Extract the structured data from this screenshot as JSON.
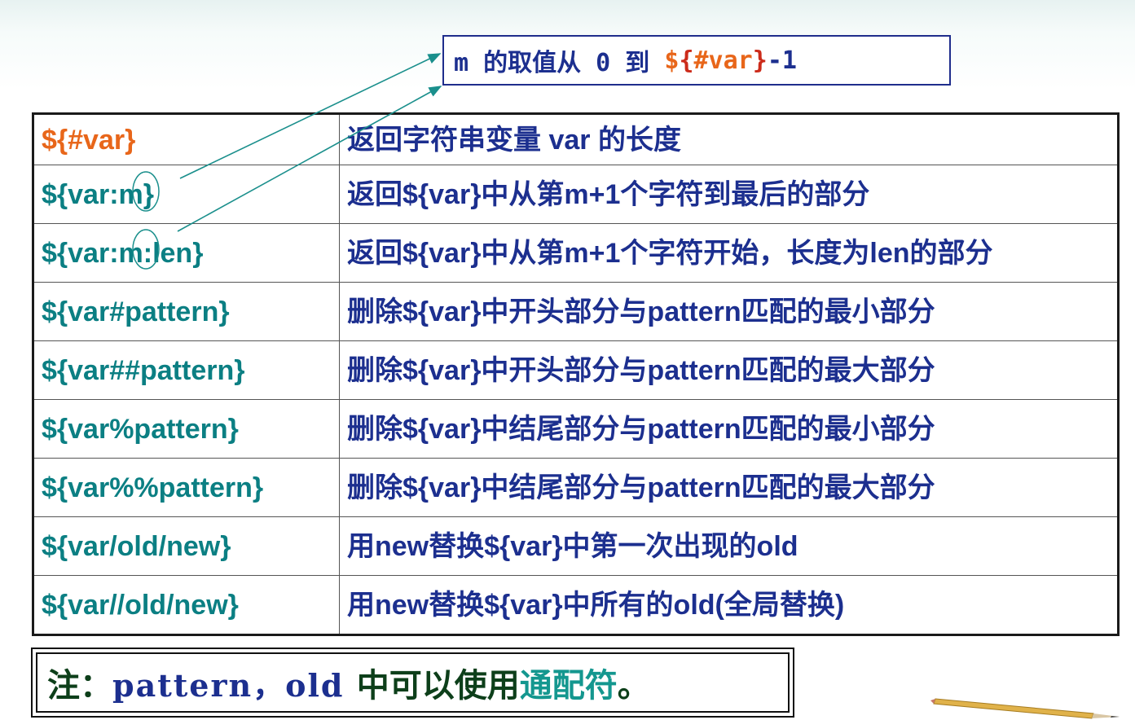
{
  "callout": {
    "prefix": "m 的取值从 0 到 ",
    "dollar": "$",
    "open": "{",
    "var": "#var",
    "close": "}",
    "suffix": "-1"
  },
  "rows": [
    {
      "expr": "${#var}",
      "desc": "返回字符串变量 var 的长度"
    },
    {
      "expr": "${var:m}",
      "desc": "返回${var}中从第m+1个字符到最后的部分"
    },
    {
      "expr": "${var:m:len}",
      "desc": "返回${var}中从第m+1个字符开始，长度为len的部分"
    },
    {
      "expr": "${var#pattern}",
      "desc": "删除${var}中开头部分与pattern匹配的最小部分"
    },
    {
      "expr": "${var##pattern}",
      "desc": "删除${var}中开头部分与pattern匹配的最大部分"
    },
    {
      "expr": "${var%pattern}",
      "desc": "删除${var}中结尾部分与pattern匹配的最小部分"
    },
    {
      "expr": "${var%%pattern}",
      "desc": "删除${var}中结尾部分与pattern匹配的最大部分"
    },
    {
      "expr": "${var/old/new}",
      "desc": "用new替换${var}中第一次出现的old"
    },
    {
      "expr": "${var//old/new}",
      "desc": "用new替换${var}中所有的old(全局替换)"
    }
  ],
  "note": {
    "label": "注：",
    "terms": "pattern，old ",
    "middle": "中可以使用",
    "highlight": "通配符",
    "end": "。"
  },
  "colors": {
    "teal": "#0b7f83",
    "navy": "#1c2f8f",
    "orange": "#e8661a",
    "red": "#cc2b1a",
    "dark_green": "#0d3f1a"
  },
  "icons": [
    "arrow-icon",
    "circle-highlight-icon",
    "pencil-icon"
  ]
}
